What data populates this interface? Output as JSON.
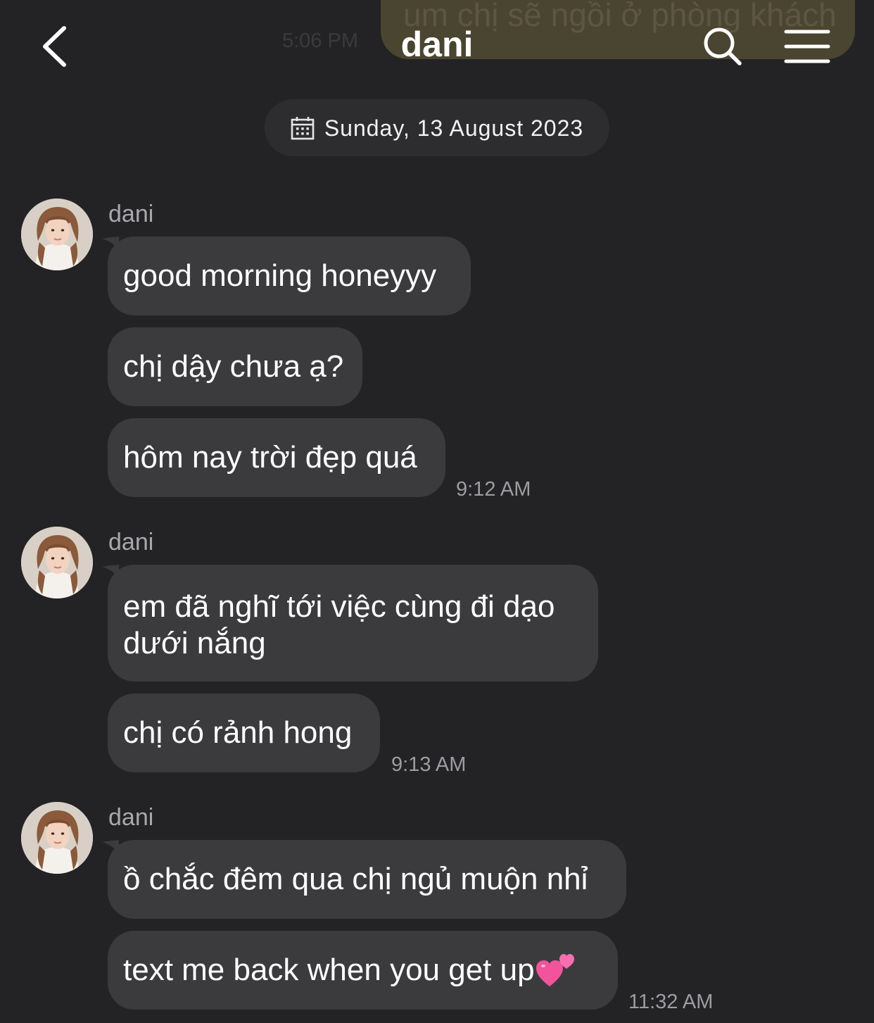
{
  "header": {
    "title": "dani",
    "prev_message_text": "um chị sẽ ngồi ở phòng khách",
    "prev_message_time": "5:06 PM",
    "back_icon": "chevron-left-icon",
    "search_icon": "search-icon",
    "menu_icon": "hamburger-menu-icon"
  },
  "date_divider": {
    "icon": "calendar-icon",
    "label": "Sunday, 13 August 2023"
  },
  "groups": [
    {
      "sender": "dani",
      "messages": [
        "good morning honeyyy",
        "chị dậy chưa ạ?",
        "hôm nay trời đẹp quá"
      ],
      "time": "9:12 AM"
    },
    {
      "sender": "dani",
      "messages": [
        "em đã nghĩ tới việc cùng đi dạo dưới nắng",
        "chị có rảnh hong"
      ],
      "time": "9:13 AM"
    },
    {
      "sender": "dani",
      "messages": [
        "ồ chắc đêm qua chị ngủ muộn nhỉ",
        "text me back when you get up"
      ],
      "time": "11:32 AM",
      "last_message_emoji": "two-hearts-emoji"
    }
  ],
  "colors": {
    "background": "#232325",
    "bubble": "#3b3b3e",
    "date_chip": "#2d2d30",
    "secondary_text": "#a8a8ad"
  }
}
